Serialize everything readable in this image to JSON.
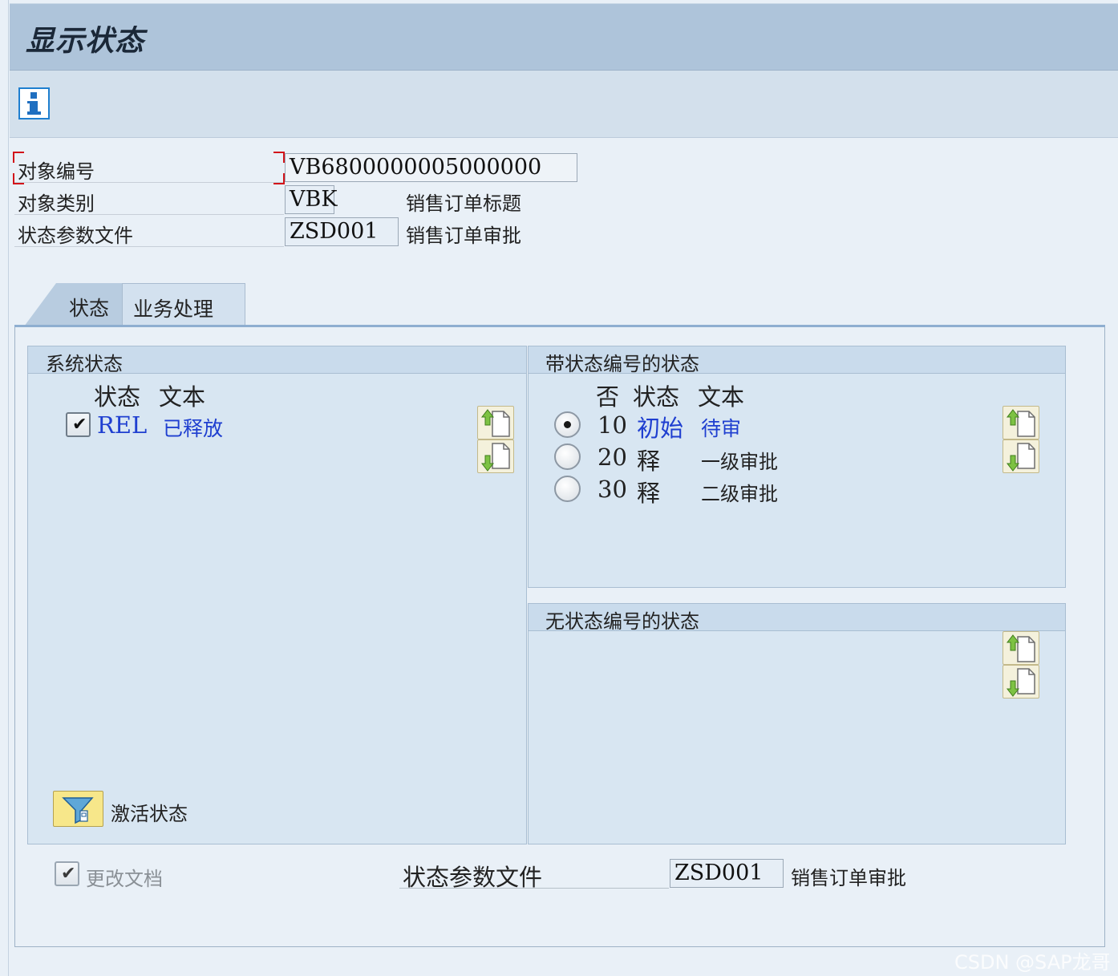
{
  "title": "显示状态",
  "toolbar": {
    "info_icon": "info-icon"
  },
  "header": {
    "object_number": {
      "label": "对象编号",
      "value": "VB6800000005000000"
    },
    "object_category": {
      "label": "对象类别",
      "value": "VBK",
      "desc": "销售订单标题"
    },
    "status_profile": {
      "label": "状态参数文件",
      "value": "ZSD001",
      "desc": "销售订单审批"
    }
  },
  "tabs": [
    {
      "label": "状态",
      "active": true
    },
    {
      "label": "业务处理",
      "active": false
    }
  ],
  "system_status": {
    "title": "系统状态",
    "columns": [
      "状态",
      "文本"
    ],
    "rows": [
      {
        "checked": true,
        "status": "REL",
        "text": "已释放"
      }
    ],
    "activate_button_icon": "filter-icon",
    "activate_label": "激活状态"
  },
  "status_with_number": {
    "title": "带状态编号的状态",
    "columns": [
      "否",
      "状态",
      "文本"
    ],
    "rows": [
      {
        "selected": true,
        "no": "10",
        "status": "初始",
        "text": "待审"
      },
      {
        "selected": false,
        "no": "20",
        "status": "释",
        "text": "一级审批"
      },
      {
        "selected": false,
        "no": "30",
        "status": "释",
        "text": "二级审批"
      }
    ]
  },
  "status_without_number": {
    "title": "无状态编号的状态"
  },
  "footer": {
    "change_docs": {
      "label": "更改文档",
      "checked": true
    },
    "status_profile": {
      "label": "状态参数文件",
      "value": "ZSD001",
      "desc": "销售订单审批"
    }
  },
  "watermark": "CSDN @SAP龙哥",
  "colors": {
    "title_bar": "#aec4da",
    "link": "#1f3fd0",
    "focus": "#d2141a",
    "tab_active": "#b8cce0"
  }
}
